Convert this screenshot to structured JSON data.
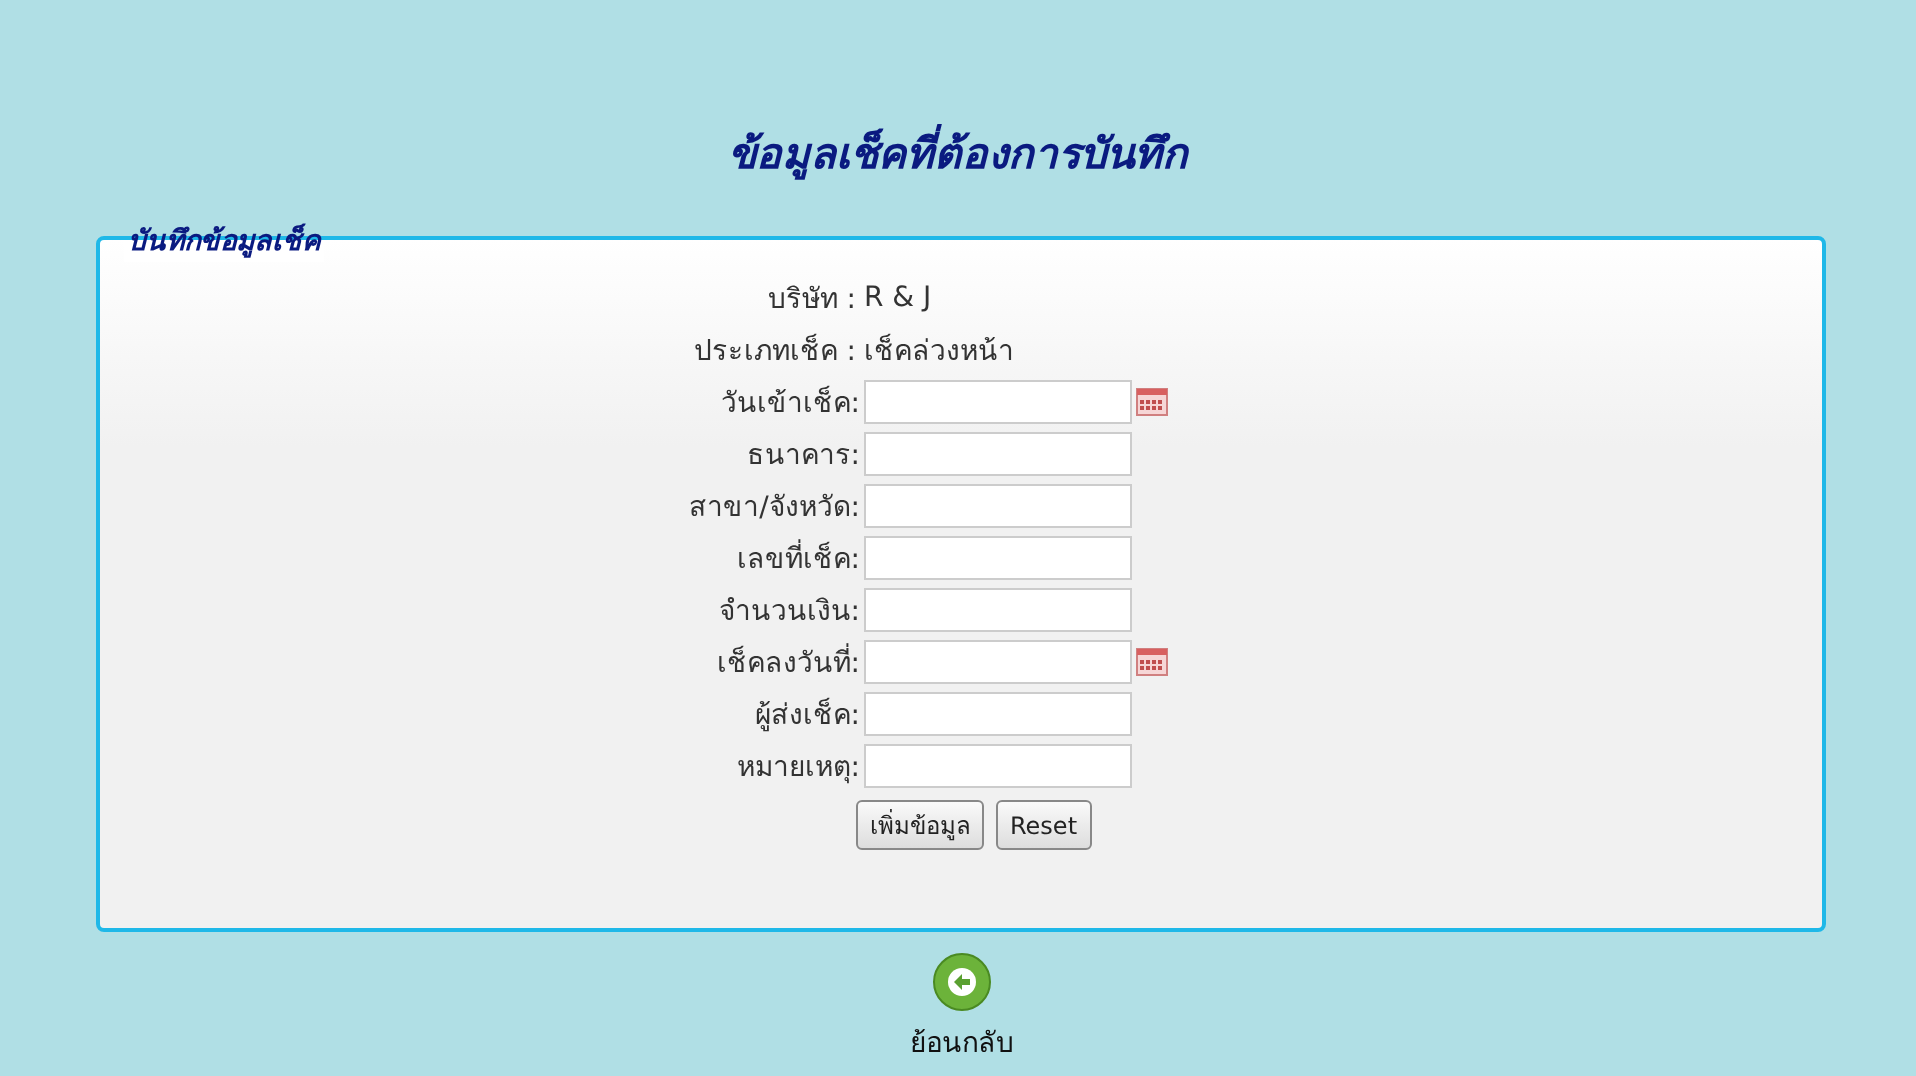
{
  "title": "ข้อมูลเช็คที่ต้องการบันทึก",
  "form": {
    "legend": "บันทึกข้อมูลเช็ค",
    "info": [
      {
        "label": "บริษัท :",
        "value": "R & J"
      },
      {
        "label": "ประเภทเช็ค :",
        "value": "เช็คล่วงหน้า"
      }
    ],
    "fields": [
      {
        "label": "วันเข้าเช็ค:",
        "kind": "date"
      },
      {
        "label": "ธนาคาร:",
        "kind": "text"
      },
      {
        "label": "สาขา/จังหวัด:",
        "kind": "text"
      },
      {
        "label": "เลขที่เช็ค:",
        "kind": "text"
      },
      {
        "label": "จำนวนเงิน:",
        "kind": "text"
      },
      {
        "label": "เช็คลงวันที่:",
        "kind": "date"
      },
      {
        "label": "ผู้ส่งเช็ค:",
        "kind": "text"
      },
      {
        "label": "หมายเหตุ:",
        "kind": "text"
      }
    ],
    "buttons": [
      "เพิ่มข้อมูล",
      "Reset"
    ]
  },
  "back": {
    "label": "ย้อนกลับ"
  }
}
